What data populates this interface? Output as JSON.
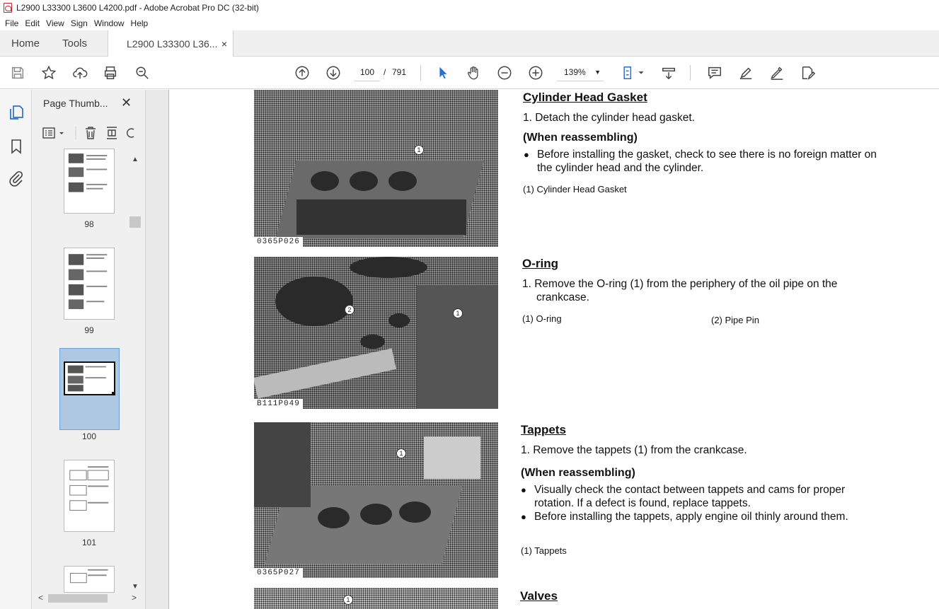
{
  "window": {
    "title": "L2900 L33300 L3600 L4200.pdf - Adobe Acrobat Pro DC (32-bit)"
  },
  "menu": [
    "File",
    "Edit",
    "View",
    "Sign",
    "Window",
    "Help"
  ],
  "tabs": {
    "home": "Home",
    "tools": "Tools",
    "doc": "L2900 L33300 L36...",
    "close": "×"
  },
  "toolbar": {
    "page_current": "100",
    "page_sep": "/",
    "page_total": "791",
    "zoom": "139%"
  },
  "panel": {
    "title": "Page Thumb...",
    "close": "✕",
    "thumbs": [
      {
        "label": "98"
      },
      {
        "label": "99"
      },
      {
        "label": "100"
      },
      {
        "label": "101"
      }
    ]
  },
  "page": {
    "sections": [
      {
        "title": "Cylinder Head Gasket",
        "step": "1. Detach the cylinder head gasket.",
        "when": "(When reassembling)",
        "bullets": [
          "Before installing the gasket, check to see there is no foreign matter on the cylinder head and the cylinder."
        ],
        "captions": [
          "(1)   Cylinder Head Gasket"
        ],
        "photo_code": "0365P026"
      },
      {
        "title": "O-ring",
        "step": "1. Remove the O-ring (1) from the periphery of the oil pipe on the crankcase.",
        "captions": [
          "(1)   O-ring",
          "(2)   Pipe Pin"
        ],
        "photo_code": "B111P049"
      },
      {
        "title": "Tappets",
        "step": "1. Remove the tappets (1) from the crankcase.",
        "when": "(When reassembling)",
        "bullets": [
          "Visually check the contact between tappets and cams for proper rotation.  If a defect is found, replace tappets.",
          "Before installing the tappets, apply engine oil thinly around them."
        ],
        "captions": [
          "(1)   Tappets"
        ],
        "photo_code": "0365P027"
      },
      {
        "title": "Valves"
      }
    ],
    "callouts": [
      "1",
      "2",
      "1",
      "1",
      "1"
    ]
  }
}
